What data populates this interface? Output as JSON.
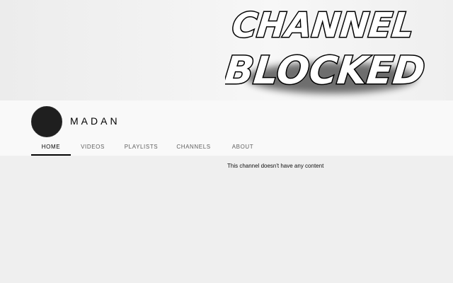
{
  "banner": {
    "line1": "CHANNEL",
    "line2": "BLOCKED"
  },
  "channel": {
    "name": "MADAN"
  },
  "tabs": [
    {
      "label": "HOME",
      "active": true
    },
    {
      "label": "VIDEOS",
      "active": false
    },
    {
      "label": "PLAYLISTS",
      "active": false
    },
    {
      "label": "CHANNELS",
      "active": false
    },
    {
      "label": "ABOUT",
      "active": false
    }
  ],
  "content": {
    "empty_message": "This channel doesn't have any content"
  },
  "colors": {
    "page_bg": "#efefef",
    "header_bg": "#f9f9f9",
    "text_primary": "#030303",
    "text_secondary": "#606060"
  }
}
